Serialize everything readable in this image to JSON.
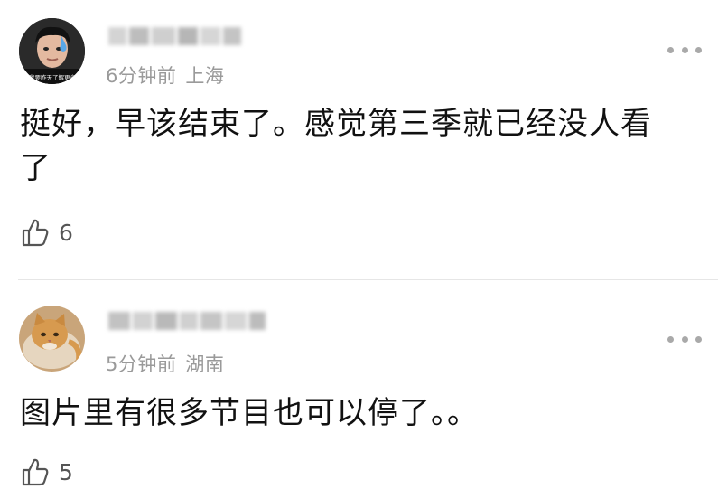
{
  "comments": [
    {
      "username": "",
      "time": "6分钟前",
      "location": "上海",
      "text_line1": "挺好，早该结束了。感觉第三季就已经没人看",
      "text_line2": "了",
      "likes": "6",
      "avatar_icon": "person-avatar-icon",
      "avatar_caption": "我要昨天了解更多"
    },
    {
      "username": "",
      "time": "5分钟前",
      "location": "湖南",
      "text_line1": "图片里有很多节目也可以停了。。",
      "likes": "5",
      "avatar_icon": "cat-avatar-icon"
    }
  ],
  "colors": {
    "text": "#111111",
    "meta": "#9a9a9a",
    "icon": "#555555",
    "divider": "#e6e6e6"
  }
}
